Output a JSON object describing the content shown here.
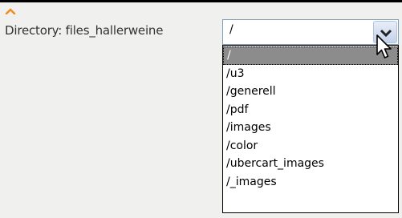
{
  "field": {
    "label": "Directory: files_hallerweine",
    "selected_value": "/"
  },
  "dropdown": {
    "options": [
      "/",
      "/u3",
      "/generell",
      "/pdf",
      "/images",
      "/color",
      "/ubercart_images",
      "/_images"
    ],
    "selected_index": 0
  },
  "colors": {
    "accent_icon": "#f08c1e",
    "selected_bg": "#8c8c8c",
    "select_border": "#7f9db9"
  },
  "icons": {
    "collapse": "chevron-up-icon",
    "dropdown": "chevron-down-icon",
    "cursor": "mouse-pointer-icon"
  }
}
